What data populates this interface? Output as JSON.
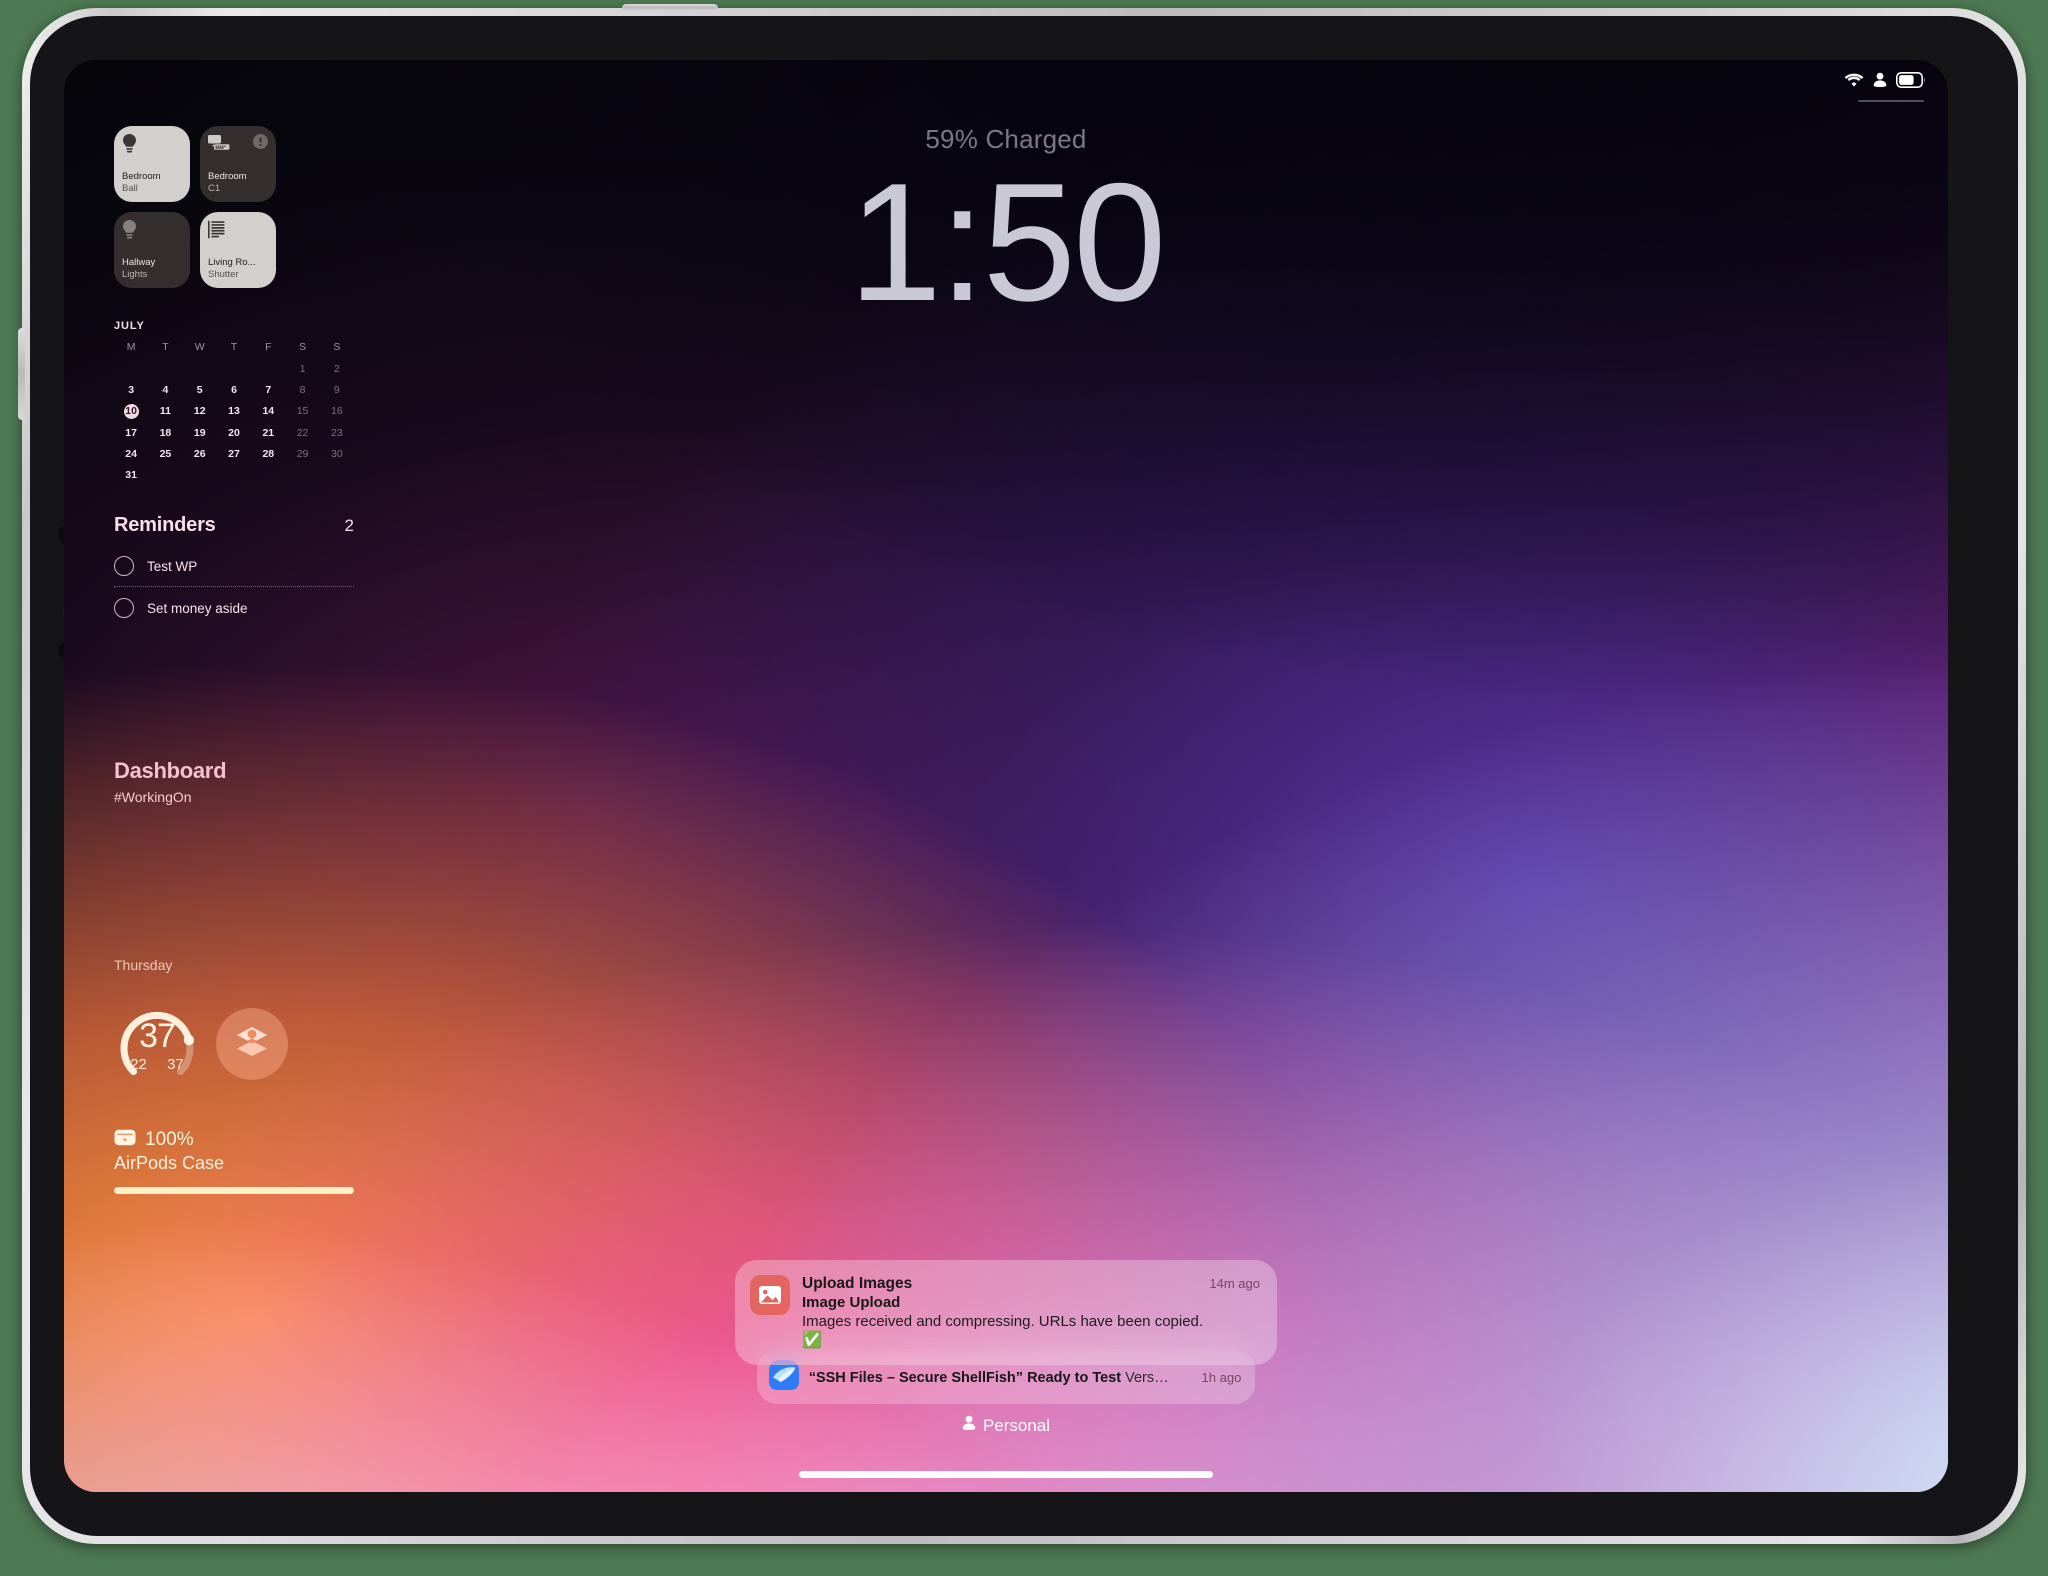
{
  "status_bar": {
    "wifi_icon": "wifi-icon",
    "focus_icon": "person-focus-icon",
    "battery_icon": "battery-icon",
    "battery_level_percent": 59
  },
  "clock": {
    "charge_status": "59% Charged",
    "time": "1:50"
  },
  "home_tiles": [
    {
      "name": "Bedroom",
      "accessory": "Ball",
      "state": "on",
      "icon": "lightbulb-icon",
      "badge": null
    },
    {
      "name": "Bedroom",
      "accessory": "C1",
      "state": "off",
      "icon": "computer-display-icon",
      "badge": "exclamation-badge-icon"
    },
    {
      "name": "Hallway",
      "accessory": "Lights",
      "state": "off",
      "icon": "lightbulb-icon",
      "badge": null
    },
    {
      "name": "Living Ro...",
      "accessory": "Shutter",
      "state": "on",
      "icon": "window-shutter-icon",
      "badge": null
    }
  ],
  "calendar": {
    "month": "JULY",
    "weekday_initials": [
      "M",
      "T",
      "W",
      "T",
      "F",
      "S",
      "S"
    ],
    "leading_blanks": 5,
    "days": [
      1,
      2,
      3,
      4,
      5,
      6,
      7,
      8,
      9,
      10,
      11,
      12,
      13,
      14,
      15,
      16,
      17,
      18,
      19,
      20,
      21,
      22,
      23,
      24,
      25,
      26,
      27,
      28,
      29,
      30,
      31
    ],
    "today": 10,
    "weekend_columns": [
      5,
      6
    ]
  },
  "reminders": {
    "title": "Reminders",
    "count": "2",
    "items": [
      {
        "text": "Test WP",
        "done": false
      },
      {
        "text": "Set money aside",
        "done": false
      }
    ]
  },
  "dashboard": {
    "title": "Dashboard",
    "subtitle": "#WorkingOn"
  },
  "day_widget": {
    "day_label": "Thursday",
    "ring": {
      "value": "37",
      "low": "22",
      "high": "37",
      "progress_percent": 78
    },
    "layers_icon": "layers-stack-icon"
  },
  "battery_widget": {
    "device_icon": "airpods-case-icon",
    "percent": "100%",
    "label": "AirPods Case",
    "fill_percent": 100
  },
  "notifications": [
    {
      "app_icon": "photo-upload-icon",
      "title": "Upload Images",
      "subtitle": "Image Upload",
      "message": "Images received and compressing. URLs have been copied.",
      "emoji": "✅",
      "time": "14m ago"
    },
    {
      "app_icon": "testflight-icon",
      "title": "“SSH Files – Secure ShellFish” Ready to Test",
      "detail": "Vers…",
      "time": "1h ago"
    }
  ],
  "focus": {
    "icon": "person-focus-icon",
    "label": "Personal"
  },
  "home_indicator": "home-indicator",
  "colors": {
    "tile_on_bg": "#d2d0cd",
    "tile_off_bg": "#383232",
    "reminders_accent": "#f8dfe8",
    "dashboard_accent": "#f7bfcf",
    "battery_fill": "#fdf0c4",
    "ring_track": "rgba(255,255,255,0.30)",
    "ring_fill": "#fff0dc",
    "notif_app_icon_bg": "#e2655f",
    "testflight_icon_bg": "#2f7df6"
  }
}
